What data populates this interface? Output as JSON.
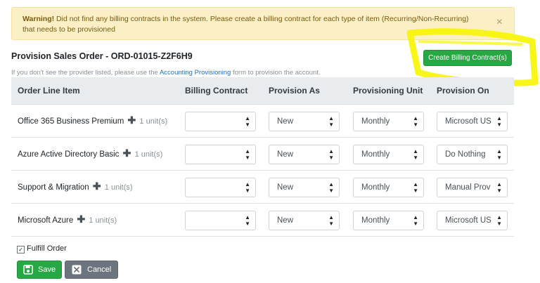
{
  "alert": {
    "strong": "Warning!",
    "message": "Did not find any billing contracts in the system. Please create a billing contract for each type of item (Recurring/Non-Recurring) that needs to be provisioned",
    "close": "×"
  },
  "order": {
    "title": "Provision Sales Order - ORD-01015-Z2F6H9",
    "create_contract_label": "Create Billing Contract(s)",
    "hint_before": "If you don't see the provider listed, please use the ",
    "hint_link": "Accounting Provisioning",
    "hint_after": " form to provision the account."
  },
  "table": {
    "headers": [
      "Order Line Item",
      "Billing Contract",
      "Provision As",
      "Provisioning Unit",
      "Provision On"
    ],
    "plus_glyph": "✚",
    "rows": [
      {
        "item": "Office 365 Business Premium",
        "units": "1 unit(s)",
        "billing_contract": "",
        "provision_as": "New",
        "unit": "Monthly",
        "provision_on": "Microsoft US"
      },
      {
        "item": "Azure Active Directory Basic",
        "units": "1 unit(s)",
        "billing_contract": "",
        "provision_as": "New",
        "unit": "Monthly",
        "provision_on": "Do Nothing"
      },
      {
        "item": "Support & Migration",
        "units": "1 unit(s)",
        "billing_contract": "",
        "provision_as": "New",
        "unit": "Monthly",
        "provision_on": "Manual Prov"
      },
      {
        "item": "Microsoft Azure",
        "units": "1 unit(s)",
        "billing_contract": "",
        "provision_as": "New",
        "unit": "Monthly",
        "provision_on": "Microsoft US"
      }
    ]
  },
  "footer": {
    "fulfill_label": "Fulfill Order",
    "fulfill_checked": true,
    "save_label": "Save",
    "cancel_label": "Cancel"
  },
  "colors": {
    "success": "#28a745",
    "secondary": "#6c757d",
    "warning_bg": "#fbefc6",
    "highlight": "#f7f500"
  }
}
